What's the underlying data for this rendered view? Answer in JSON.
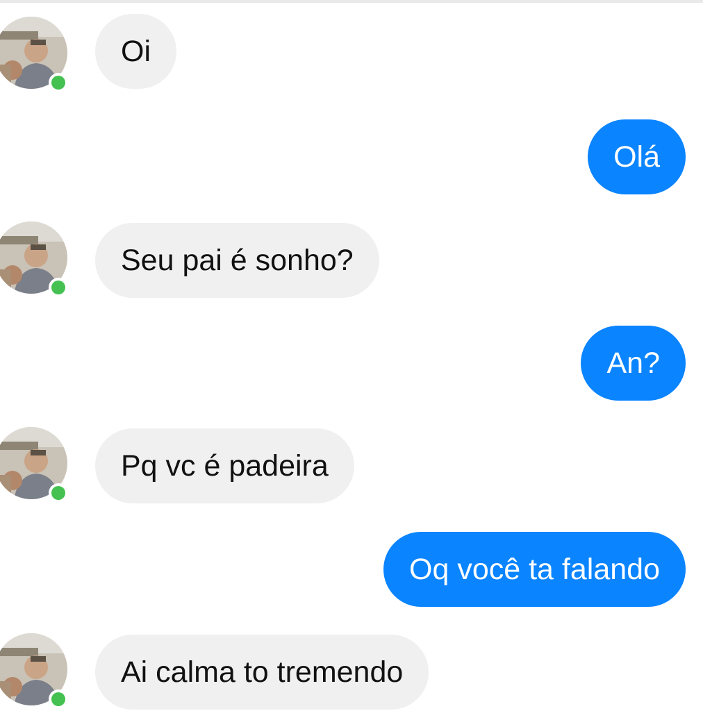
{
  "colors": {
    "incoming_bubble": "#f0f0f0",
    "outgoing_bubble": "#0a84ff",
    "online_dot": "#44c150",
    "background": "#ffffff"
  },
  "contact": {
    "status": "online",
    "avatar_icon": "user-photo-avatar"
  },
  "messages": [
    {
      "direction": "incoming",
      "text": "Oi"
    },
    {
      "direction": "outgoing",
      "text": "Olá"
    },
    {
      "direction": "incoming",
      "text": "Seu pai é sonho?"
    },
    {
      "direction": "outgoing",
      "text": "An?"
    },
    {
      "direction": "incoming",
      "text": "Pq vc é padeira"
    },
    {
      "direction": "outgoing",
      "text": "Oq você ta falando"
    },
    {
      "direction": "incoming",
      "text": "Ai calma to tremendo"
    }
  ]
}
